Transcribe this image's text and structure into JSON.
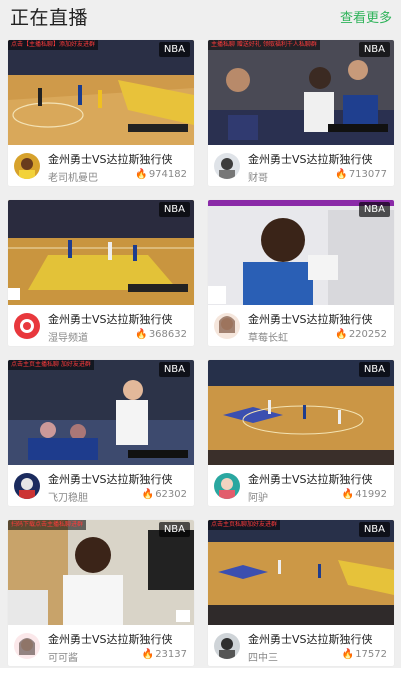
{
  "header": {
    "title": "正在直播",
    "more": "查看更多"
  },
  "badge_label": "NBA",
  "cards": [
    {
      "match": "金州勇士VS达拉斯独行侠",
      "user": "老司机曼巴",
      "views": "974182",
      "overlay": "点击【主播私聊】添加好友进群"
    },
    {
      "match": "金州勇士VS达拉斯独行侠",
      "user": "财哥",
      "views": "713077",
      "overlay": "主播私聊 赠送好礼 领取福利千人私聊群"
    },
    {
      "match": "金州勇士VS达拉斯独行侠",
      "user": "湿导频道",
      "views": "368632",
      "overlay": ""
    },
    {
      "match": "金州勇士VS达拉斯独行侠",
      "user": "草莓长虹",
      "views": "220252",
      "overlay": ""
    },
    {
      "match": "金州勇士VS达拉斯独行侠",
      "user": "飞刀稳胆",
      "views": "62302",
      "overlay": "点击主页主播私聊 加好友进群"
    },
    {
      "match": "金州勇士VS达拉斯独行侠",
      "user": "阿驴",
      "views": "41992",
      "overlay": ""
    },
    {
      "match": "金州勇士VS达拉斯独行侠",
      "user": "可可酱",
      "views": "23137",
      "overlay": "扫码下载点击主播私聊进群"
    },
    {
      "match": "金州勇士VS达拉斯独行侠",
      "user": "四中三",
      "views": "17572",
      "overlay": "点击主页私聊加好友进群"
    }
  ],
  "colors": {
    "accent": "#2fb35a",
    "fire": "#e94b3c"
  }
}
